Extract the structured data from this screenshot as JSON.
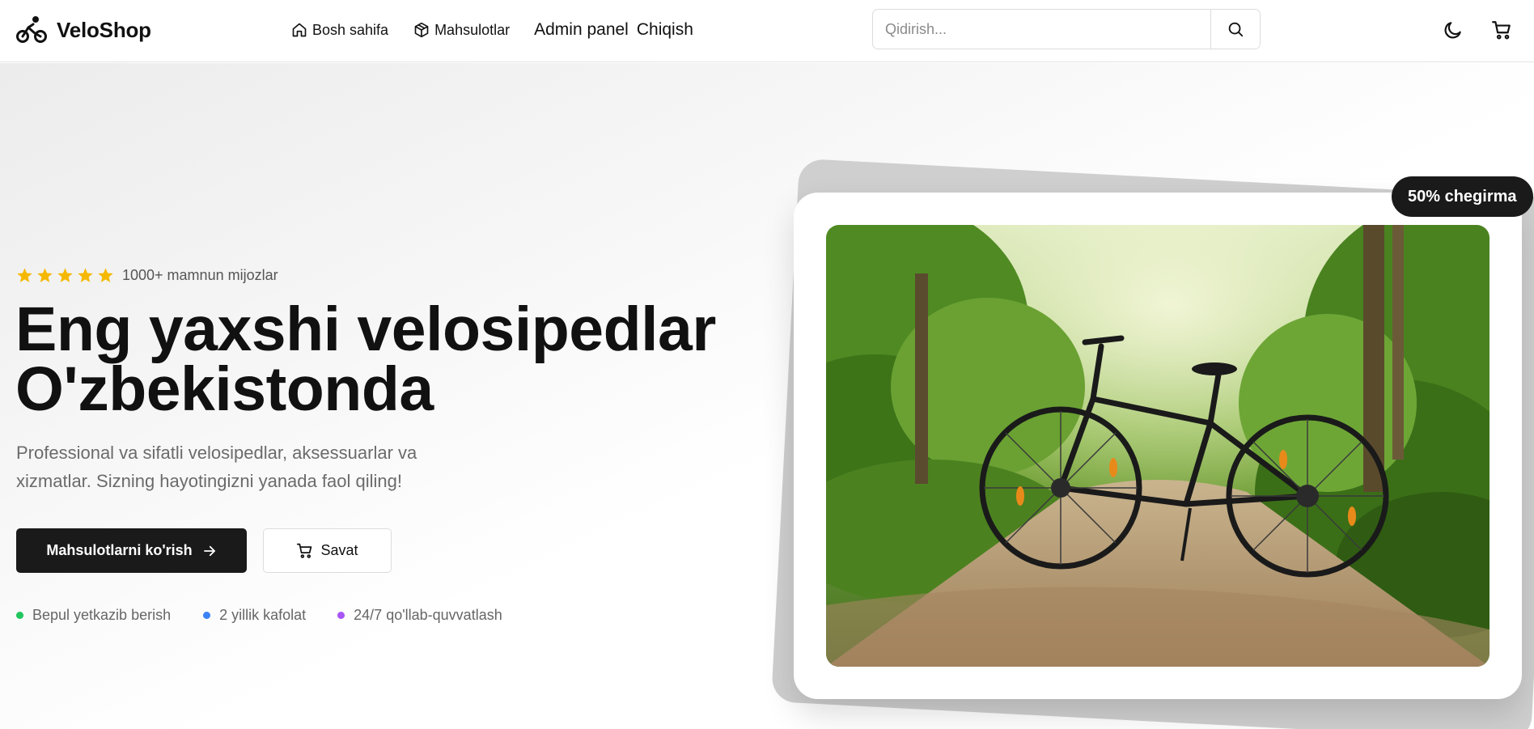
{
  "brand": {
    "name": "VeloShop",
    "icon": "bicycle-icon"
  },
  "nav": {
    "home_label": "Bosh sahifa",
    "products_label": "Mahsulotlar",
    "admin_label": "Admin panel",
    "logout_label": "Chiqish"
  },
  "search": {
    "placeholder": "Qidirish...",
    "value": ""
  },
  "header_icons": {
    "theme": "moon-icon",
    "cart": "cart-icon"
  },
  "hero": {
    "rating": {
      "stars": 5,
      "text": "1000+ mamnun mijozlar",
      "star_color": "#f5b800"
    },
    "title_line1": "Eng yaxshi velosipedlar",
    "title_line2": "O'zbekistonda",
    "description": "Professional va sifatli velosipedlar, aksessuarlar va xizmatlar. Sizning hayotingizni yanada faol qiling!",
    "primary_button": "Mahsulotlarni ko'rish",
    "secondary_button": "Savat",
    "features": [
      {
        "label": "Bepul yetkazib berish",
        "color": "#22c55e"
      },
      {
        "label": "2 yillik kafolat",
        "color": "#3b82f6"
      },
      {
        "label": "24/7 qo'llab-quvvatlash",
        "color": "#a855f7"
      }
    ],
    "badge": "50% chegirma",
    "image": "bicycle-on-forest-path-photo"
  },
  "colors": {
    "dark": "#1a1a1a",
    "text": "#111111",
    "muted": "#6b6b6b",
    "border": "#dcdcdc"
  }
}
